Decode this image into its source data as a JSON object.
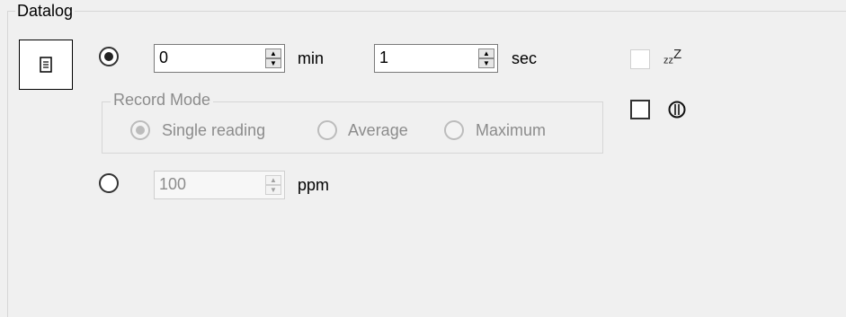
{
  "group": {
    "title": "Datalog"
  },
  "doc_button": {
    "icon": "document-icon",
    "glyph": "🗎"
  },
  "time_mode": {
    "selected": true,
    "minutes": {
      "value": "0",
      "unit": "min"
    },
    "seconds": {
      "value": "1",
      "unit": "sec"
    }
  },
  "record_mode": {
    "title": "Record Mode",
    "options": [
      "Single reading",
      "Average",
      "Maximum"
    ],
    "selected": "Single reading"
  },
  "ppm_mode": {
    "selected": false,
    "value": "100",
    "unit": "ppm"
  },
  "sleep": {
    "icon": "sleep-icon",
    "glyph": "zz",
    "glyph_sup": "Z",
    "checked": false
  },
  "power": {
    "icon": "power-icon",
    "glyph": "⏀",
    "checked": false
  }
}
